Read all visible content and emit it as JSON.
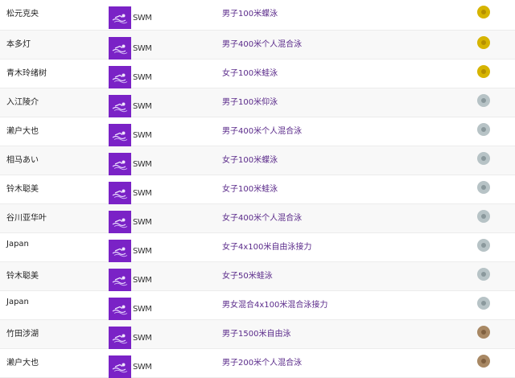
{
  "sport_label": "SWM",
  "medal_colors": {
    "gold": "#d6b400",
    "silver": "#b7c3c6",
    "bronze": "#a88864"
  },
  "rows": [
    {
      "athlete": "松元克央",
      "sport": "SWM",
      "event": "男子100米蝶泳",
      "medal": "gold"
    },
    {
      "athlete": "本多灯",
      "sport": "SWM",
      "event": "男子400米个人混合泳",
      "medal": "gold"
    },
    {
      "athlete": "青木玲绪树",
      "sport": "SWM",
      "event": "女子100米蛙泳",
      "medal": "gold"
    },
    {
      "athlete": "入江陵介",
      "sport": "SWM",
      "event": "男子100米仰泳",
      "medal": "silver"
    },
    {
      "athlete": "濑户大也",
      "sport": "SWM",
      "event": "男子400米个人混合泳",
      "medal": "silver"
    },
    {
      "athlete": "相马あい",
      "sport": "SWM",
      "event": "女子100米蝶泳",
      "medal": "silver"
    },
    {
      "athlete": "铃木聪美",
      "sport": "SWM",
      "event": "女子100米蛙泳",
      "medal": "silver"
    },
    {
      "athlete": "谷川亚华叶",
      "sport": "SWM",
      "event": "女子400米个人混合泳",
      "medal": "silver"
    },
    {
      "athlete": "Japan",
      "sport": "SWM",
      "event": "女子4x100米自由泳接力",
      "medal": "silver"
    },
    {
      "athlete": "铃木聪美",
      "sport": "SWM",
      "event": "女子50米蛙泳",
      "medal": "silver"
    },
    {
      "athlete": "Japan",
      "sport": "SWM",
      "event": "男女混合4x100米混合泳接力",
      "medal": "silver"
    },
    {
      "athlete": "竹田涉湖",
      "sport": "SWM",
      "event": "男子1500米自由泳",
      "medal": "bronze"
    },
    {
      "athlete": "濑户大也",
      "sport": "SWM",
      "event": "男子200米个人混合泳",
      "medal": "bronze"
    }
  ]
}
